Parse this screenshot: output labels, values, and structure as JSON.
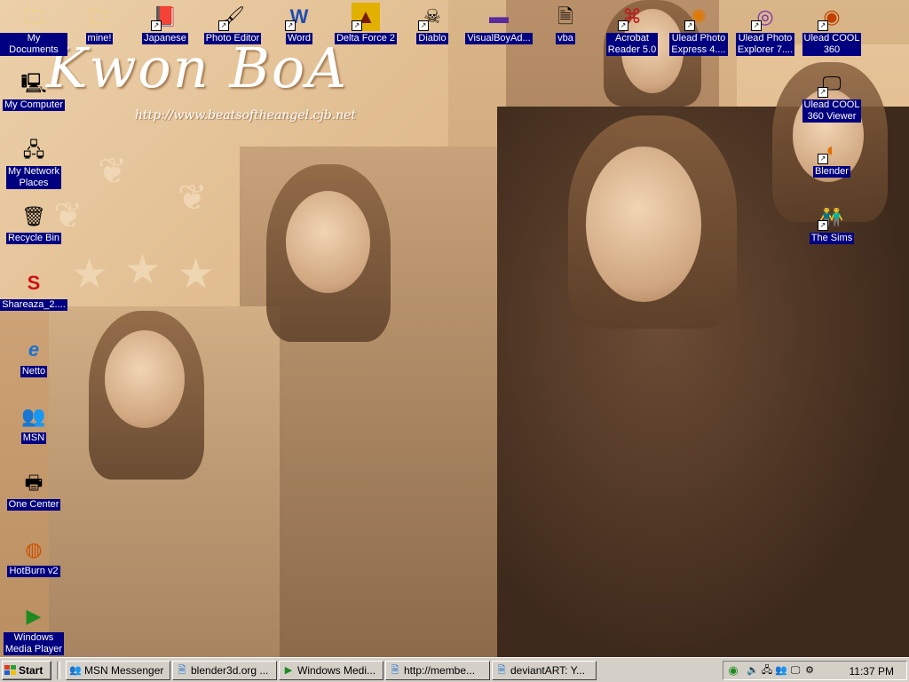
{
  "wallpaper": {
    "title": "Kwon BoA",
    "url": "http://www.beatsoftheangel.cjb.net"
  },
  "desktop_icons": {
    "my_documents": "My Documents",
    "mine": "mine!",
    "japanese": "Japanese",
    "photo_editor": "Photo Editor",
    "word": "Word",
    "delta_force": "Delta Force 2",
    "diablo": "Diablo",
    "visualboy": "VisualBoyAd...",
    "vba": "vba",
    "acrobat": "Acrobat\nReader 5.0",
    "ulead_express": "Ulead Photo\nExpress 4....",
    "ulead_explorer": "Ulead Photo\nExplorer 7....",
    "ulead_cool": "Ulead COOL\n360",
    "my_computer": "My Computer",
    "ulead_cool_viewer": "Ulead COOL\n360 Viewer",
    "my_network": "My Network\nPlaces",
    "blender": "Blender",
    "recycle_bin": "Recycle Bin",
    "the_sims": "The Sims",
    "shareaza": "Shareaza_2....",
    "netto": "Netto",
    "msn": "MSN",
    "one_center": "One Center",
    "hotburn": "HotBurn v2",
    "windows_media": "Windows\nMedia Player"
  },
  "taskbar": {
    "start_label": "Start",
    "tasks": [
      "MSN Messenger",
      "blender3d.org ...",
      "Windows Medi...",
      "http://membe...",
      "deviantART: Y..."
    ],
    "clock": "11:37 PM"
  },
  "colors": {
    "desktop_selection": "#000080",
    "taskbar": "#d4d0c8",
    "wallpaper_tone": "#caa073"
  }
}
